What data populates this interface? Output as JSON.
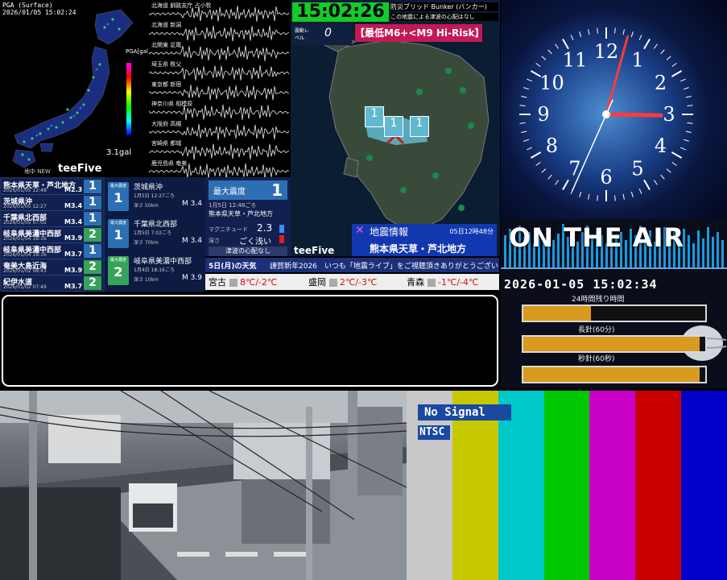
{
  "pga": {
    "title": "PGA (Surface)",
    "timestamp": "2026/01/05 15:02:24",
    "unit": "PGA[gal]",
    "max_value": "3.1gal",
    "new_label": "地中 NEW",
    "logo": "teeFive"
  },
  "waveforms": {
    "stations": [
      "北海道 釧路支庁 占小牧",
      "北海道 新潟",
      "北関東 足尾",
      "埼玉県 秩父",
      "東京都 新宿",
      "神奈川県 相模原",
      "大阪府 高槻",
      "宮崎県 都城",
      "鹿児島県 奄美"
    ]
  },
  "eq_list": {
    "items": [
      {
        "name": "熊本県天草・芦北地方",
        "time": "2026/01/05 12:48",
        "mag": "M2.3",
        "shindo": "1",
        "color": "#2d6fb3"
      },
      {
        "name": "茨城県沖",
        "time": "2026/01/05 12:27",
        "mag": "M3.4",
        "shindo": "1",
        "color": "#2d6fb3"
      },
      {
        "name": "千葉県北西部",
        "time": "2026/01/05 07:02",
        "mag": "M3.4",
        "shindo": "1",
        "color": "#2d6fb3"
      },
      {
        "name": "岐阜県美濃中西部",
        "time": "2026/01/04 18:16",
        "mag": "M3.9",
        "shindo": "2",
        "color": "#35a35a"
      },
      {
        "name": "岐阜県美濃中西部",
        "time": "2026/01/04 18:16",
        "mag": "M3.7",
        "shindo": "1",
        "color": "#2d6fb3"
      },
      {
        "name": "奄美大島近海",
        "time": "2026/01/02 08:43",
        "mag": "M3.9",
        "shindo": "2",
        "color": "#35a35a"
      },
      {
        "name": "紀伊水道",
        "time": "2026/01/02 07:49",
        "mag": "M3.7",
        "shindo": "2",
        "color": "#35a35a"
      }
    ]
  },
  "eq_detail": {
    "label": "最大震度",
    "items": [
      {
        "name": "茨城県沖",
        "time": "1月5日 12:27ごろ",
        "depth": "深さ 50km",
        "mag": "M 3.4",
        "shindo": "1"
      },
      {
        "name": "千葉県北西部",
        "time": "1月5日 7:02ごろ",
        "depth": "深さ 70km",
        "mag": "M 3.4",
        "shindo": "1"
      },
      {
        "name": "岐阜県美濃中西部",
        "time": "1月4日 18:16ごろ",
        "depth": "深さ 10km",
        "mag": "M 3.9",
        "shindo": "2"
      }
    ]
  },
  "maxint": {
    "label": "最大震度",
    "value": "1",
    "time": "1月5日 12:48ごろ",
    "region": "熊本県天草・芦北地方",
    "mag_label": "マグニチュード",
    "mag": "2.3",
    "depth_label": "深さ",
    "depth": "ごく浅い",
    "tsunami": "津波の心配なし"
  },
  "weather": {
    "date": "5日(月)の天気",
    "ticker": "謹賀新年2026　いつも「地震ライブ」をご視聴頂きありがとうございます!",
    "cities": [
      {
        "name": "宮古",
        "temp": "8℃/-2℃"
      },
      {
        "name": "盛岡",
        "temp": "2℃/-3℃"
      },
      {
        "name": "青森",
        "temp": "-1℃/-4℃"
      }
    ]
  },
  "kyushu": {
    "time": "15:02:26",
    "bunker": "防災ブリッド Bunker (バンカー)",
    "tsunami_note": "この地震による津波の心配はなし",
    "level_label": "震動レベル",
    "level": "0",
    "risk": "【最低M6+<M9 Hi-Risk】",
    "info_title": "地震情報",
    "info_time": "05日12時48分",
    "info_region": "熊本県天草・芦北地方",
    "logo": "teeFive",
    "markers": [
      "1",
      "1",
      "1"
    ]
  },
  "clock": {
    "numbers": [
      "12",
      "1",
      "2",
      "3",
      "4",
      "5",
      "6",
      "7",
      "8",
      "9",
      "10",
      "11"
    ],
    "hour": 15,
    "minute": 2,
    "second": 34
  },
  "onair": {
    "title": "ON THE AIR",
    "datetime": "2026-01-05 15:02:34",
    "bars": [
      {
        "label": "24時間残り時間",
        "fraction": 0.37
      },
      {
        "label": "長針(60分)",
        "fraction": 0.97
      },
      {
        "label": "秒針(60秒)",
        "fraction": 0.97
      }
    ]
  },
  "colorbars": {
    "no_signal": "No Signal",
    "standard": "NTSC",
    "colors": [
      "#c8c8c8",
      "#c8c800",
      "#00c8c8",
      "#00c800",
      "#c800c8",
      "#c80000",
      "#0000c8"
    ]
  }
}
